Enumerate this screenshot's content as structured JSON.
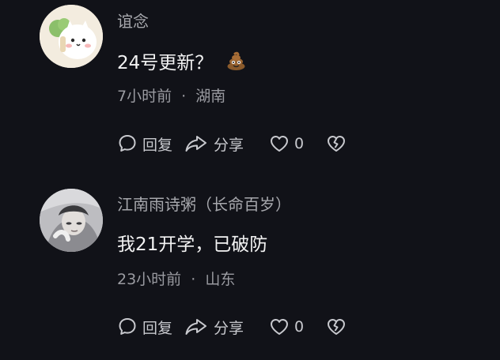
{
  "comments": [
    {
      "username": "谊念",
      "text": "24号更新？",
      "time": "7小时前",
      "separator": "·",
      "location": "湖南",
      "reply_label": "回复",
      "share_label": "分享",
      "like_count": "0"
    },
    {
      "username": "江南雨诗粥（长命百岁）",
      "text": "我21开学，已破防",
      "time": "23小时前",
      "separator": "·",
      "location": "山东",
      "reply_label": "回复",
      "share_label": "分享",
      "like_count": "0"
    }
  ],
  "icons": {
    "reply": "comment-bubble-icon",
    "share": "share-arrow-icon",
    "like": "heart-icon",
    "dislike": "broken-heart-icon",
    "emoji": "poop-emoji"
  },
  "colors": {
    "background": "#111218",
    "username": "#a7a8ad",
    "text": "#f3f3f3",
    "meta": "#9a9ba1",
    "action": "#c8c9ce"
  }
}
